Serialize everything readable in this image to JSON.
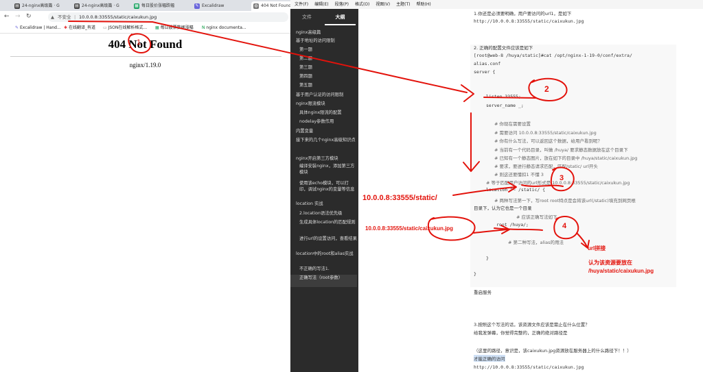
{
  "browser": {
    "tabs": [
      {
        "icon": "book-icon",
        "title": "24-nginx高级篇 · G"
      },
      {
        "icon": "book-icon",
        "title": "24-nginx高级篇 · G"
      },
      {
        "icon": "chart-icon",
        "title": "每日股价涨幅跌幅"
      },
      {
        "icon": "excalidraw-icon",
        "title": "Excalidraw"
      },
      {
        "icon": "globe-icon",
        "title": "404 Not Found"
      }
    ],
    "security_label": "不安全",
    "url": "10.0.0.8:33555/static/caixukun.jpg",
    "bookmarks": [
      {
        "icon": "excalidraw-icon",
        "label": "Excalidraw | Hand..."
      },
      {
        "icon": "translate-icon",
        "label": "在线翻译_有道"
      },
      {
        "icon": "json-icon",
        "label": "JSON在线解析格式..."
      },
      {
        "icon": "chart-icon",
        "label": "每日股票数据涨幅"
      },
      {
        "icon": "nginx-icon",
        "label": "nginx documenta..."
      }
    ],
    "page": {
      "title": "404 Not Found",
      "server": "nginx/1.19.0"
    }
  },
  "typora": {
    "menu": [
      "文件(F)",
      "编辑(E)",
      "段落(P)",
      "格式(O)",
      "视图(V)",
      "主题(T)",
      "帮助(H)"
    ],
    "sidebar_tabs": [
      "文件",
      "大纲"
    ],
    "outline": [
      {
        "text": "nginx高级篇",
        "indent": 0
      },
      {
        "text": "基于地址的访问限制",
        "indent": 0
      },
      {
        "text": "第一题",
        "indent": 1
      },
      {
        "text": "第二题",
        "indent": 1
      },
      {
        "text": "第三题",
        "indent": 1
      },
      {
        "text": "第四题",
        "indent": 1
      },
      {
        "text": "第五题",
        "indent": 1
      },
      {
        "text": "基于用户认证的访问限制",
        "indent": 0
      },
      {
        "text": "nginx限流模块",
        "indent": 0
      },
      {
        "text": "具体nginx限流的配置",
        "indent": 1
      },
      {
        "text": "nodelay参数作用",
        "indent": 1
      },
      {
        "text": "内置变量",
        "indent": 0
      },
      {
        "text": "接下来的几个nginx高级知识点",
        "indent": 0
      },
      {
        "text": "nginx开启第三方模块",
        "indent": 0
      },
      {
        "text": "编译安装nginx，添加第三方模块",
        "indent": 1
      },
      {
        "text": "使用该echo模块，可以打印，调试nginx的变量等信息",
        "indent": 1
      },
      {
        "text": "location 实战",
        "indent": 0
      },
      {
        "text": "2.location语法优先级",
        "indent": 1
      },
      {
        "text": "生成具体location的匹配规则",
        "indent": 1
      },
      {
        "text": "进行url的设置访问，查看结果",
        "indent": 1
      },
      {
        "text": "location中的root和alias实战",
        "indent": 0
      },
      {
        "text": "不正确的写法1.",
        "indent": 1
      },
      {
        "text": "正确写法（root参数）",
        "indent": 1
      }
    ],
    "editor_lines": [
      "1.你还是必须要明确，用户要访问的url1，是如下",
      "http://10.0.0.8:33555/static/caixukun.jpg",
      "2. 正确的配置文件应该是如下",
      "[root@web-8 /huya/static]#cat /opt/nginx-1-19-0/conf/extra/",
      "alias.conf",
      "server {",
      "listen 33555;",
      "server_name _;",
      "# 你现在需要设置",
      "# 需要访问 10.0.0.8:33555/static/caixukun.jpg",
      "#  你有什么写法，可以返回这个数据，给用户看到呢？",
      "# 当前有一个代码目录，叫做 /huya/ 要求静态数据放在这个目录下",
      "# 已知有一个静态图片，放在如下的目录中 /huya/static/caixukun.jpg",
      "# 要求，要进行静态请求匹配，匹配/static/ url开头",
      "# 则这还要懂扣1 不懂 3",
      "# 等于匹配用户访问的url形式是  10.0.0.8:33555/static/caixukun.jpg",
      "location ^~ /static/ {",
      "# 两种写法第一下，写root  root特点是会将该url(/static)填充到网页根",
      "目录下，认为它也是一个目录",
      "# 应该正确写法如下",
      "root  /huya/;",
      "# 第二种写法，alias的用法",
      "}",
      "}",
      "重启服务",
      "3.按照这个写法的话，该资源文件应该是需止在什么位置？",
      "给我发弹幕，你觉得完整的，正确的绝对路径是",
      "（这里的路径，意识是，该caixukun.jpg资源放在服务器上的什么路径下！！）",
      "才能正确的访问",
      "http://10.0.0.8:33555/static/caixukun.jpg"
    ]
  },
  "annotations": {
    "url_part1": "10.0.0.8:33555/static/",
    "url_part2": "10.0.0.8:33555/static/caixukun.jpg",
    "url_concat": "url拼接",
    "conclusion_line1": "认为该资源要放在",
    "conclusion_line2": "/huya/static/caixukun.jpg",
    "circle_numbers": [
      "1",
      "2",
      "3",
      "4"
    ]
  },
  "colors": {
    "annotation": "#e3120b",
    "sidebar_bg": "#2b2b2b",
    "page_bg": "#ffffff"
  }
}
